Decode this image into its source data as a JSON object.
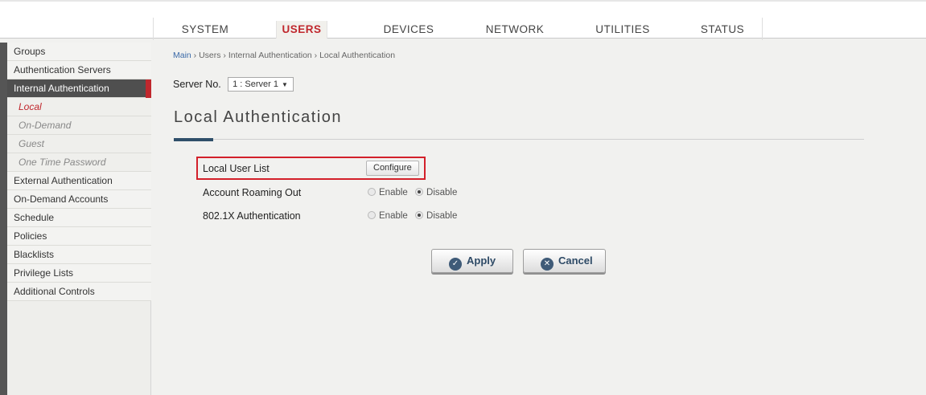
{
  "nav": {
    "tabs": [
      {
        "label": "SYSTEM"
      },
      {
        "label": "USERS"
      },
      {
        "label": "DEVICES"
      },
      {
        "label": "NETWORK"
      },
      {
        "label": "UTILITIES"
      },
      {
        "label": "STATUS"
      }
    ],
    "active_tab": "USERS"
  },
  "sidebar": {
    "items": [
      {
        "label": "Groups"
      },
      {
        "label": "Authentication Servers"
      },
      {
        "label": "Internal Authentication"
      },
      {
        "label": "Local"
      },
      {
        "label": "On-Demand"
      },
      {
        "label": "Guest"
      },
      {
        "label": "One Time Password"
      },
      {
        "label": "External Authentication"
      },
      {
        "label": "On-Demand Accounts"
      },
      {
        "label": "Schedule"
      },
      {
        "label": "Policies"
      },
      {
        "label": "Blacklists"
      },
      {
        "label": "Privilege Lists"
      },
      {
        "label": "Additional Controls"
      }
    ]
  },
  "breadcrumb": {
    "main": "Main",
    "rest": " › Users › Internal Authentication › Local Authentication"
  },
  "server": {
    "label": "Server No.",
    "selected": "1 : Server 1"
  },
  "page": {
    "title": "Local Authentication"
  },
  "form": {
    "local_user_list": {
      "label": "Local User List",
      "button": "Configure"
    },
    "roaming": {
      "label": "Account Roaming Out",
      "enable": "Enable",
      "disable": "Disable",
      "selected": "Disable"
    },
    "dot1x": {
      "label": "802.1X Authentication",
      "enable": "Enable",
      "disable": "Disable",
      "selected": "Disable"
    }
  },
  "actions": {
    "apply": "Apply",
    "cancel": "Cancel"
  },
  "colors": {
    "accent_red": "#c0272d",
    "button_text": "#2e4a66",
    "sidebar_active": "#4f4f4f"
  }
}
